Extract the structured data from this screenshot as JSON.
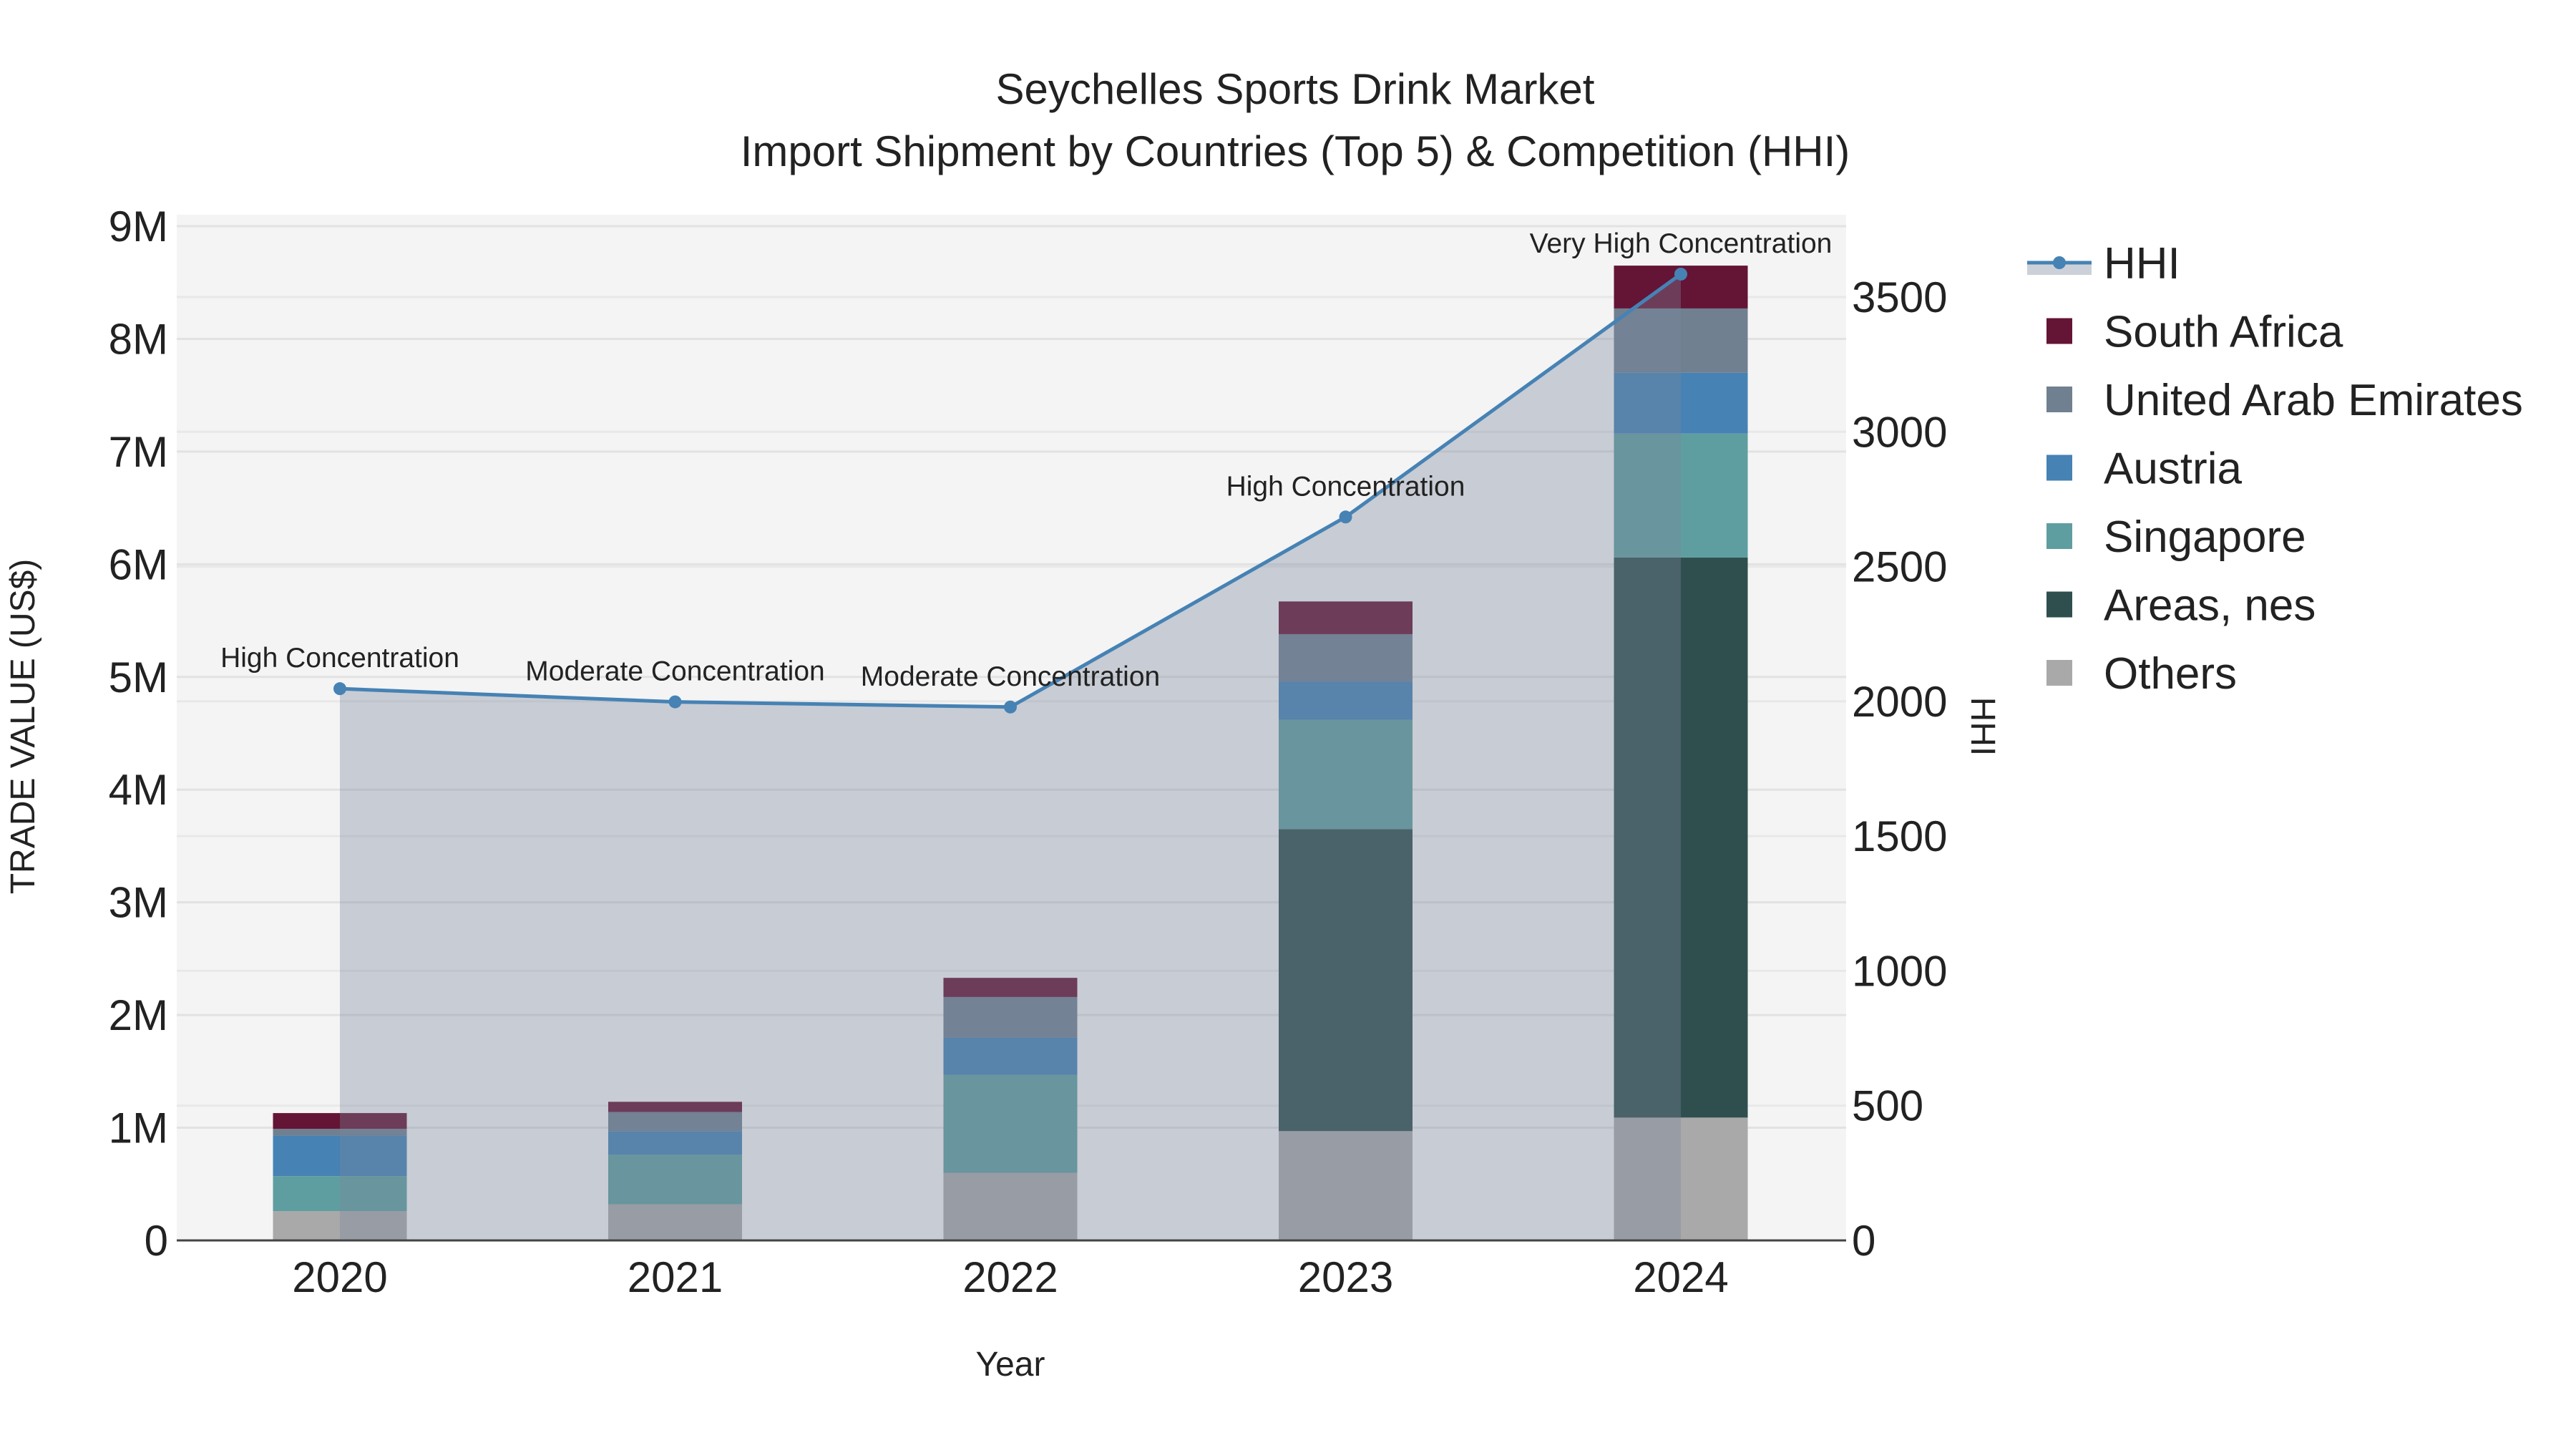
{
  "chart_data": {
    "type": "bar",
    "title": "Seychelles Sports Drink Market",
    "subtitle": "Import Shipment by Countries (Top 5) & Competition (HHI)",
    "xlabel": "Year",
    "ylabel": "TRADE VALUE (US$)",
    "y2label": "HHI",
    "categories": [
      "2020",
      "2021",
      "2022",
      "2023",
      "2024"
    ],
    "ylim": [
      0,
      9000000
    ],
    "y2lim": [
      0,
      3800
    ],
    "yticks": [
      {
        "v": 0,
        "label": "0"
      },
      {
        "v": 1000000,
        "label": "1M"
      },
      {
        "v": 2000000,
        "label": "2M"
      },
      {
        "v": 3000000,
        "label": "3M"
      },
      {
        "v": 4000000,
        "label": "4M"
      },
      {
        "v": 5000000,
        "label": "5M"
      },
      {
        "v": 6000000,
        "label": "6M"
      },
      {
        "v": 7000000,
        "label": "7M"
      },
      {
        "v": 8000000,
        "label": "8M"
      },
      {
        "v": 9000000,
        "label": "9M"
      }
    ],
    "y2ticks": [
      {
        "v": 0,
        "label": "0"
      },
      {
        "v": 500,
        "label": "500"
      },
      {
        "v": 1000,
        "label": "1000"
      },
      {
        "v": 1500,
        "label": "1500"
      },
      {
        "v": 2000,
        "label": "2000"
      },
      {
        "v": 2500,
        "label": "2500"
      },
      {
        "v": 3000,
        "label": "3000"
      },
      {
        "v": 3500,
        "label": "3500"
      }
    ],
    "grid": true,
    "legend_position": "right",
    "series": [
      {
        "name": "Others",
        "color": "#a9a9a9",
        "values": [
          260000,
          320000,
          600000,
          970000,
          1090000
        ]
      },
      {
        "name": "Areas, nes",
        "color": "#2f4f4f",
        "values": [
          0,
          0,
          0,
          2680000,
          4970000
        ]
      },
      {
        "name": "Singapore",
        "color": "#5f9ea0",
        "values": [
          310000,
          440000,
          870000,
          970000,
          1100000
        ]
      },
      {
        "name": "Austria",
        "color": "#4682b4",
        "values": [
          360000,
          210000,
          330000,
          340000,
          540000
        ]
      },
      {
        "name": "United Arab Emirates",
        "color": "#708090",
        "values": [
          60000,
          170000,
          360000,
          420000,
          570000
        ]
      },
      {
        "name": "South Africa",
        "color": "#641435",
        "values": [
          140000,
          90000,
          170000,
          290000,
          380000
        ]
      }
    ],
    "hhi": {
      "name": "HHI",
      "color": "#4682b4",
      "values": [
        2047,
        1998,
        1979,
        2684,
        3585
      ],
      "annotations": [
        "High Concentration",
        "Moderate Concentration",
        "Moderate Concentration",
        "High Concentration",
        "Very High Concentration"
      ]
    },
    "legend_order": [
      "HHI",
      "South Africa",
      "United Arab Emirates",
      "Austria",
      "Singapore",
      "Areas, nes",
      "Others"
    ]
  }
}
